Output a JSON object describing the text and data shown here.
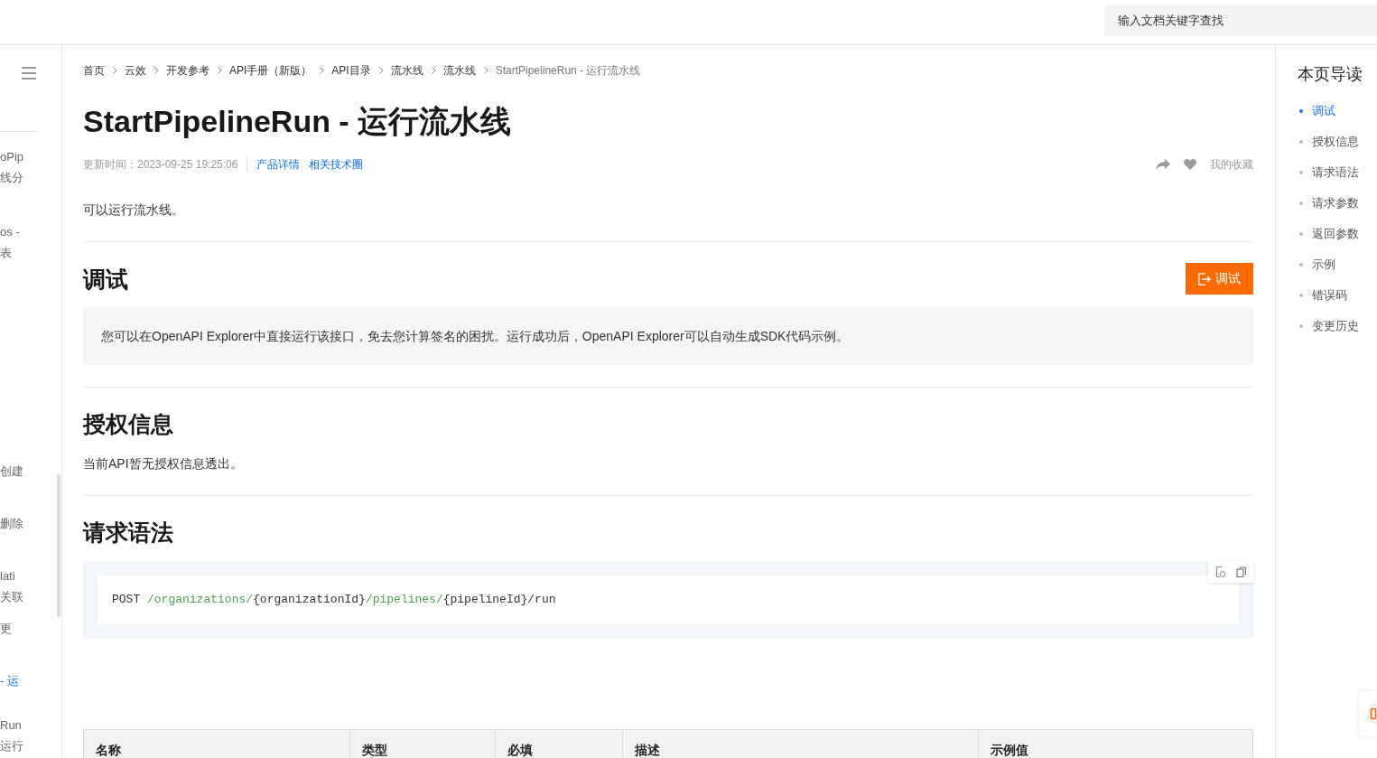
{
  "header": {
    "search": {
      "placeholder": "输入文档关键字查找"
    }
  },
  "sidebar": {
    "items": [
      {
        "lines": [
          "oPip",
          "线分"
        ],
        "selected": false
      },
      {
        "lines": [
          "os -",
          "表"
        ],
        "selected": false
      },
      {
        "lines": [
          "创建"
        ],
        "selected": false
      },
      {
        "lines": [
          "删除"
        ],
        "selected": false
      },
      {
        "lines": [
          "lati",
          "关联"
        ],
        "selected": false
      },
      {
        "lines": [
          "更"
        ],
        "selected": false
      },
      {
        "lines": [
          "- 运"
        ],
        "selected": true
      },
      {
        "lines": [
          "Run",
          "运行"
        ],
        "selected": false
      }
    ]
  },
  "breadcrumb": [
    {
      "text": "首页",
      "current": false
    },
    {
      "text": "云效",
      "current": false
    },
    {
      "text": "开发参考",
      "current": false
    },
    {
      "text": "API手册（新版）",
      "current": false
    },
    {
      "text": "API目录",
      "current": false
    },
    {
      "text": "流水线",
      "current": false
    },
    {
      "text": "流水线",
      "current": false
    },
    {
      "text": "StartPipelineRun - 运行流水线",
      "current": true
    }
  ],
  "title": "StartPipelineRun - 运行流水线",
  "meta": {
    "updated": "更新时间：2023-09-25 19:25:06",
    "links": [
      "产品详情",
      "相关技术圈"
    ],
    "favorites": "我的收藏"
  },
  "description": "可以运行流水线。",
  "sections": [
    {
      "kind": "debug",
      "heading": "调试",
      "button": "调试",
      "note": "您可以在OpenAPI Explorer中直接运行该接口，免去您计算签名的困扰。运行成功后，OpenAPI Explorer可以自动生成SDK代码示例。"
    },
    {
      "kind": "text",
      "heading": "授权信息",
      "text": "当前API暂无授权信息透出。"
    },
    {
      "kind": "code",
      "heading": "请求语法",
      "code": [
        {
          "kind": "plain",
          "text": "POST "
        },
        {
          "kind": "path",
          "text": "/organizations/"
        },
        {
          "kind": "plain",
          "text": "{organizationId}"
        },
        {
          "kind": "path",
          "text": "/pipelines/"
        },
        {
          "kind": "plain",
          "text": "{pipelineId}/run"
        }
      ]
    }
  ],
  "table": {
    "columns": [
      "名称",
      "类型",
      "必填",
      "描述",
      "示例值"
    ]
  },
  "toc": {
    "title": "本页导读",
    "items": [
      {
        "text": "调试",
        "selected": true
      },
      {
        "text": "授权信息",
        "selected": false
      },
      {
        "text": "请求语法",
        "selected": false
      },
      {
        "text": "请求参数",
        "selected": false
      },
      {
        "text": "返回参数",
        "selected": false
      },
      {
        "text": "示例",
        "selected": false
      },
      {
        "text": "错误码",
        "selected": false
      },
      {
        "text": "变更历史",
        "selected": false
      }
    ]
  }
}
